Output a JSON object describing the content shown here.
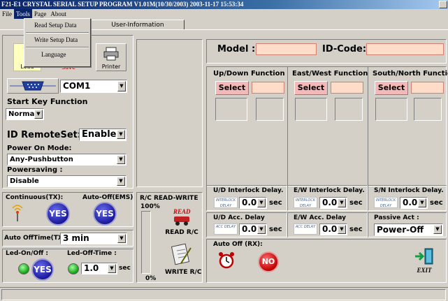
{
  "window": {
    "title": "F21-E1 CRYSTAL SERIAL SETUP PROGRAM V1.01M(10/30/2003)  2003-11-17  15:53:34"
  },
  "menu": {
    "file": "File",
    "tools": "Tools",
    "page": "Page",
    "about": "About"
  },
  "tools_menu": {
    "read": "Read Setup Data",
    "write": "Write Setup Data",
    "language": "Language"
  },
  "tabs": {
    "second": "User-Information"
  },
  "toolbar": {
    "load": "Load",
    "save": "Save",
    "printer": "Printer"
  },
  "port": {
    "value": "COM1"
  },
  "start_key": {
    "label": "Start Key Function",
    "value": "Normal"
  },
  "id_remote": {
    "label": "ID RemoteSet:",
    "value": "Enable"
  },
  "power_on": {
    "label": "Power On Mode:",
    "value": "Any-Pushbutton"
  },
  "powersaving": {
    "label": "Powersaving :",
    "value": "Disable"
  },
  "continuous": {
    "label": "Continuous(TX):",
    "state": "YES"
  },
  "auto_off_ems": {
    "label": "Auto-Off(EMS)",
    "state": "YES"
  },
  "auto_off_time": {
    "label": "Auto OffTime(TX):",
    "value": "3  min"
  },
  "led_on_off": {
    "label": "Led-On/Off :",
    "state": "YES"
  },
  "led_off_time": {
    "label": "Led-Off-Time :",
    "value": "1.0",
    "unit": "sec"
  },
  "rc": {
    "label": "R/C READ-WRITE",
    "top_pct": "100%",
    "bottom_pct": "0%",
    "progress": 0,
    "read_label": "READ R/C",
    "write_label": "WRITE R/C",
    "read_icon_text": "READ"
  },
  "model": {
    "label": "Model :",
    "id_label": "ID-Code:"
  },
  "functions": [
    {
      "title": "Up/Down Function",
      "select": "Select"
    },
    {
      "title": "East/West Function",
      "select": "Select"
    },
    {
      "title": "South/North Function",
      "select": "Select"
    }
  ],
  "interlock": [
    {
      "label": "U/D Interlock Delay.",
      "value": "0.0",
      "unit": "sec",
      "icon_text": "INTERLOCK DELAY"
    },
    {
      "label": "E/W Interlock Delay.",
      "value": "0.0",
      "unit": "sec",
      "icon_text": "INTERLOCK DELAY"
    },
    {
      "label": "S/N Interlock Delay.",
      "value": "0.0",
      "unit": "sec",
      "icon_text": "INTERLOCK DELAY"
    }
  ],
  "acc_delay": [
    {
      "label": "U/D Acc. Delay",
      "value": "0.0",
      "unit": "sec",
      "icon_text": "ACC DELAY"
    },
    {
      "label": "E/W Acc. Delay",
      "value": "0.0",
      "unit": "sec",
      "icon_text": "ACC DELAY"
    }
  ],
  "passive": {
    "label": "Passive Act :",
    "value": "Power-Off"
  },
  "auto_off_rx": {
    "label": "Auto Off (RX):",
    "state": "NO"
  },
  "exit": {
    "label": "EXIT"
  },
  "colors": {
    "titlebar": "#0a246a",
    "select_button": "#f4b8b8",
    "field_pink": "#ffdcc8",
    "yes_blue": "#1a1a9a",
    "no_red": "#c00000"
  }
}
